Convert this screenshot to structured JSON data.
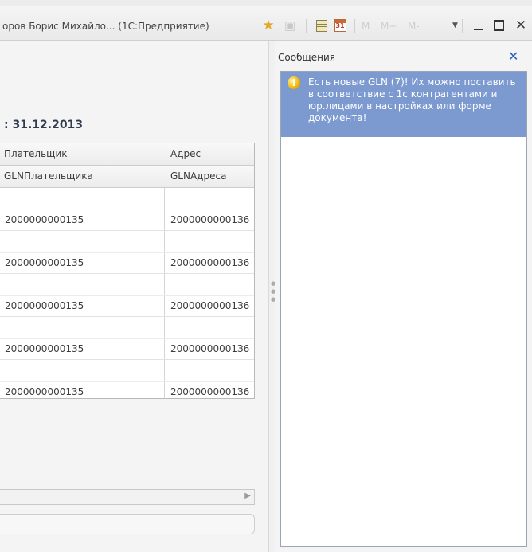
{
  "window": {
    "title": "оров Борис Михайло... (1С:Предприятие)",
    "memory_buttons": [
      "M",
      "M+",
      "M-"
    ]
  },
  "document": {
    "date_label": ": 31.12.2013",
    "columns": {
      "header1": [
        "Плательщик",
        "Адрес"
      ],
      "header2": [
        "GLNПлательщика",
        "GLNАдреса"
      ]
    },
    "rows": [
      {
        "payer": "",
        "payer_gln": "2000000000135",
        "address": "",
        "address_gln": "20000000001З6"
      },
      {
        "payer": "",
        "payer_gln": "2000000000135",
        "address": "",
        "address_gln": "20000000001З6"
      },
      {
        "payer": "",
        "payer_gln": "2000000000135",
        "address": "",
        "address_gln": "20000000001З6"
      },
      {
        "payer": "",
        "payer_gln": "2000000000135",
        "address": "",
        "address_gln": "20000000001З6"
      },
      {
        "payer": "",
        "payer_gln": "2000000000135",
        "address": "",
        "address_gln": "20000000001З6"
      }
    ]
  },
  "messages": {
    "title": "Сообщения",
    "items": [
      {
        "text": "Есть новые GLN (7)! Их можно поставить в соответствие с 1с контрагентами и юр.лицами в настройках или форме документа!"
      }
    ]
  },
  "icons": {
    "favorite": "star-icon",
    "history": "history-icon",
    "calculator": "calculator-icon",
    "calendar": "calendar-icon",
    "warning": "warning-icon",
    "close": "close-icon"
  },
  "colors": {
    "message_highlight": "#7c9ad0",
    "close_accent": "#1d5fbf",
    "warning": "#f0b400"
  }
}
